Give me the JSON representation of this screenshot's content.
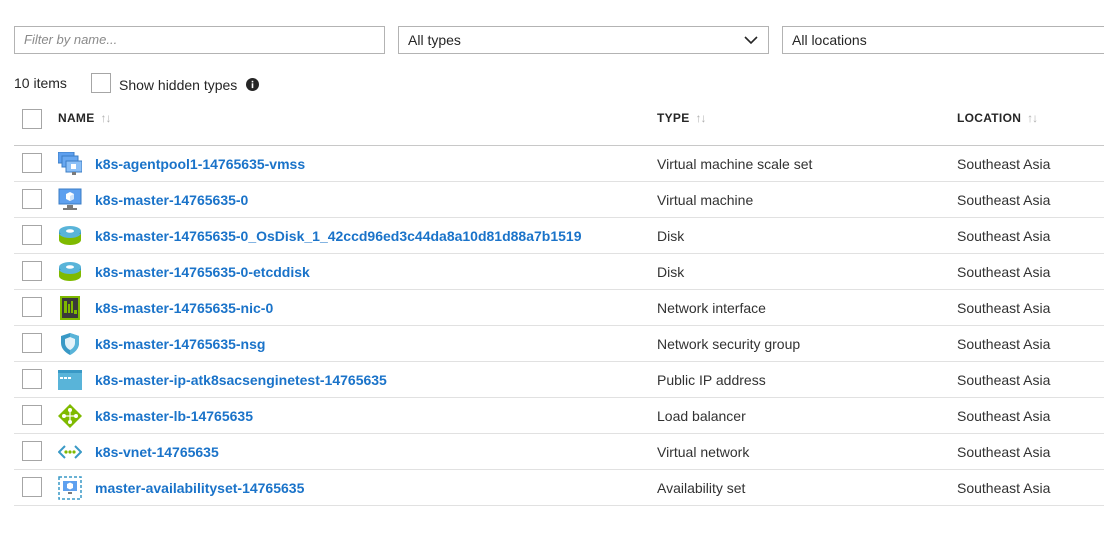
{
  "filters": {
    "name_placeholder": "Filter by name...",
    "type_value": "All types",
    "location_value": "All locations"
  },
  "summary": {
    "count": "10 items",
    "show_hidden_label": "Show hidden types"
  },
  "table": {
    "headers": {
      "name": "NAME",
      "type": "TYPE",
      "location": "LOCATION"
    },
    "rows": [
      {
        "name": "k8s-agentpool1-14765635-vmss",
        "type": "Virtual machine scale set",
        "location": "Southeast Asia",
        "icon": "vm-scale-set-icon"
      },
      {
        "name": "k8s-master-14765635-0",
        "type": "Virtual machine",
        "location": "Southeast Asia",
        "icon": "virtual-machine-icon"
      },
      {
        "name": "k8s-master-14765635-0_OsDisk_1_42ccd96ed3c44da8a10d81d88a7b1519",
        "type": "Disk",
        "location": "Southeast Asia",
        "icon": "disk-icon"
      },
      {
        "name": "k8s-master-14765635-0-etcddisk",
        "type": "Disk",
        "location": "Southeast Asia",
        "icon": "disk-icon"
      },
      {
        "name": "k8s-master-14765635-nic-0",
        "type": "Network interface",
        "location": "Southeast Asia",
        "icon": "network-interface-icon"
      },
      {
        "name": "k8s-master-14765635-nsg",
        "type": "Network security group",
        "location": "Southeast Asia",
        "icon": "network-security-group-icon"
      },
      {
        "name": "k8s-master-ip-atk8sacsenginetest-14765635",
        "type": "Public IP address",
        "location": "Southeast Asia",
        "icon": "public-ip-icon"
      },
      {
        "name": "k8s-master-lb-14765635",
        "type": "Load balancer",
        "location": "Southeast Asia",
        "icon": "load-balancer-icon"
      },
      {
        "name": "k8s-vnet-14765635",
        "type": "Virtual network",
        "location": "Southeast Asia",
        "icon": "virtual-network-icon"
      },
      {
        "name": "master-availabilityset-14765635",
        "type": "Availability set",
        "location": "Southeast Asia",
        "icon": "availability-set-icon"
      }
    ]
  },
  "colors": {
    "link": "#1a73c9",
    "border": "#b3b3b3"
  }
}
